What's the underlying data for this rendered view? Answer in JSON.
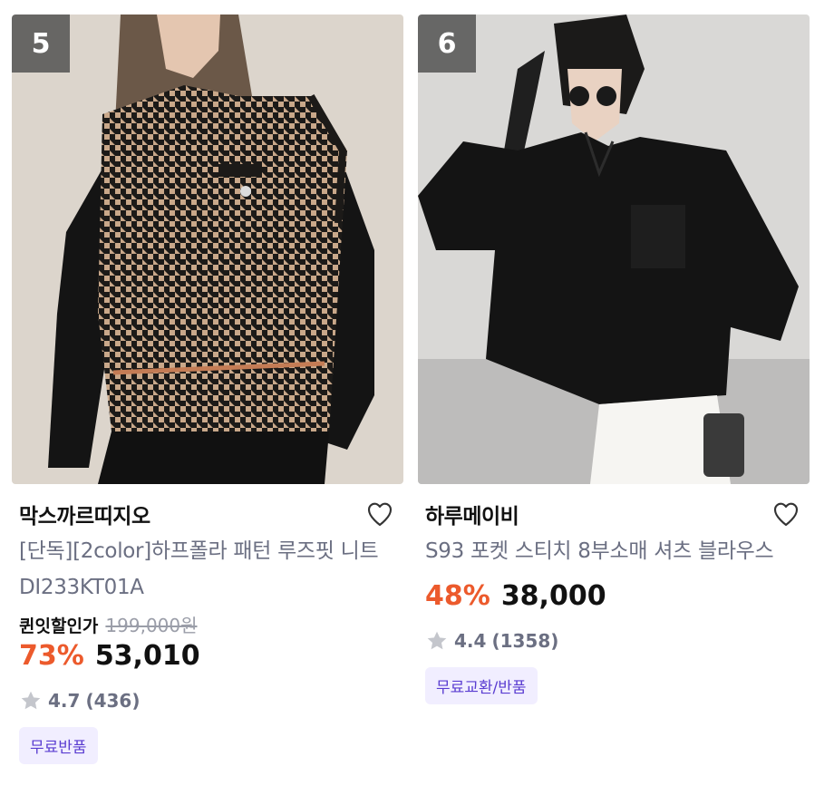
{
  "products": [
    {
      "rank": "5",
      "brand": "막스까르띠지오",
      "name": "[단독][2color]하프폴라 패턴 루즈핏 니트 DI233KT01A",
      "quin_label": "퀸잇할인가",
      "original_price": "199,000원",
      "discount": "73%",
      "price": "53,010",
      "rating": "4.7",
      "reviews": "(436)",
      "badge": "무료반품",
      "icons": {
        "wishlist": "heart-outline-icon",
        "rating": "star-icon"
      }
    },
    {
      "rank": "6",
      "brand": "하루메이비",
      "name": "S93 포켓 스티치 8부소매 셔츠 블라우스",
      "discount": "48%",
      "price": "38,000",
      "rating": "4.4",
      "reviews": "(1358)",
      "badge": "무료교환/반품",
      "icons": {
        "wishlist": "heart-outline-icon",
        "rating": "star-icon"
      }
    }
  ],
  "colors": {
    "discount": "#ec5a2c",
    "badge_bg": "#f1eeff",
    "badge_text": "#5a3dd1",
    "muted_text": "#6b6f82"
  }
}
